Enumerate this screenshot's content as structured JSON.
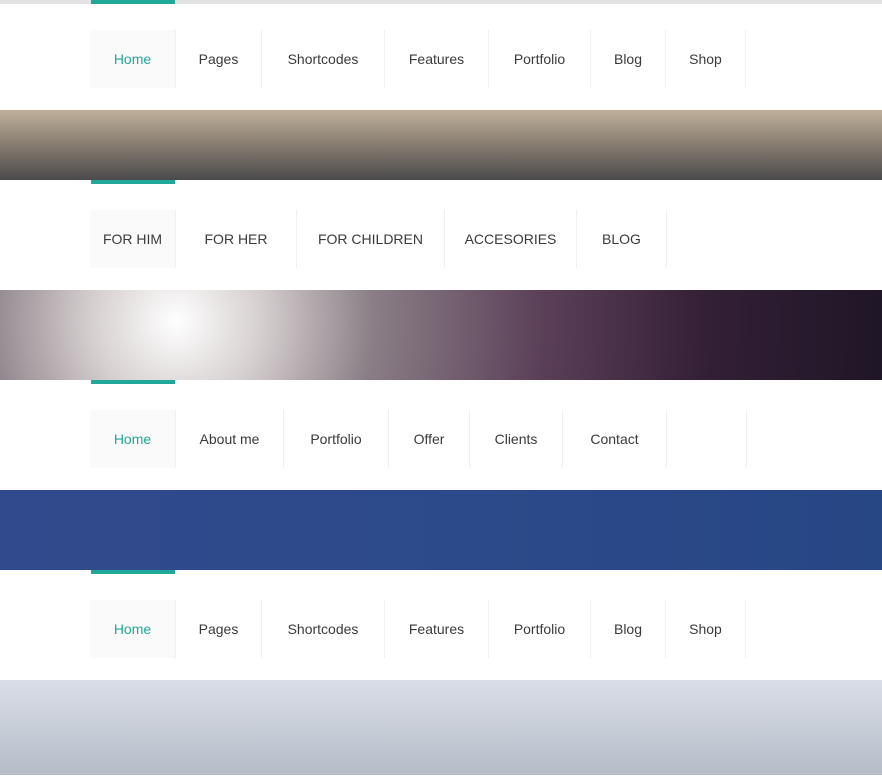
{
  "colors": {
    "accent": "#20a89a",
    "text": "#3a3a3a"
  },
  "menus": [
    {
      "items": [
        "Home",
        "Pages",
        "Shortcodes",
        "Features",
        "Portfolio",
        "Blog",
        "Shop"
      ]
    },
    {
      "items": [
        "FOR HIM",
        "FOR HER",
        "FOR CHILDREN",
        "ACCESORIES",
        "BLOG"
      ]
    },
    {
      "items": [
        "Home",
        "About me",
        "Portfolio",
        "Offer",
        "Clients",
        "Contact"
      ]
    },
    {
      "items": [
        "Home",
        "Pages",
        "Shortcodes",
        "Features",
        "Portfolio",
        "Blog",
        "Shop"
      ]
    }
  ],
  "banners": [
    "city-aerial-photo",
    "space-nebula-photo",
    "origami-blue-photo",
    "origami-gray-photo"
  ]
}
